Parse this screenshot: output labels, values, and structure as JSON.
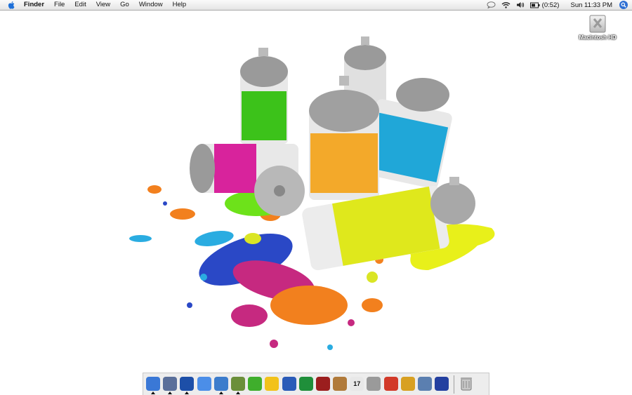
{
  "menubar": {
    "apple_icon": "apple-icon",
    "app_name": "Finder",
    "menus": [
      "File",
      "Edit",
      "View",
      "Go",
      "Window",
      "Help"
    ],
    "status": {
      "icons": [
        "speech-bubble-icon",
        "wifi-icon",
        "volume-icon",
        "battery-icon"
      ],
      "battery_time": "(0:52)",
      "clock": "Sun 11:33 PM",
      "search_icon": "spotlight-icon"
    }
  },
  "desktop": {
    "drive_label": "Macintosh HD",
    "wallpaper": "spray paint cans with colorful paint splatter"
  },
  "dock": {
    "apps": [
      {
        "name": "finder-icon",
        "color": "#3a78d6",
        "running": true
      },
      {
        "name": "mail-stamp-icon",
        "color": "#5a6f9a",
        "running": true
      },
      {
        "name": "globe-network-icon",
        "color": "#1d4fa8",
        "running": true
      },
      {
        "name": "ichat-icon",
        "color": "#4b8ee8",
        "running": false
      },
      {
        "name": "itunes-icon",
        "color": "#3c7ccc",
        "running": true
      },
      {
        "name": "pen-icon",
        "color": "#6b8f3a",
        "running": true
      },
      {
        "name": "green-swirl-icon",
        "color": "#3fae2c",
        "running": false
      },
      {
        "name": "duck-icon",
        "color": "#f2c21a",
        "running": false
      },
      {
        "name": "word-icon",
        "color": "#2a5bb8",
        "running": false
      },
      {
        "name": "green-star-icon",
        "color": "#1f8f3a",
        "running": false
      },
      {
        "name": "photo-booth-icon",
        "color": "#9b1e1e",
        "running": false
      },
      {
        "name": "iphoto-icon",
        "color": "#b07a3a",
        "running": false
      },
      {
        "name": "ical-icon",
        "color": "#e8e8e8",
        "running": false
      },
      {
        "name": "system-prefs-icon",
        "color": "#9a9a9a",
        "running": false
      },
      {
        "name": "red-app-icon",
        "color": "#d23a2a",
        "running": false
      },
      {
        "name": "warcraft-icon",
        "color": "#d8a022",
        "running": false
      },
      {
        "name": "headset-icon",
        "color": "#5b7fb0",
        "running": false
      },
      {
        "name": "wizard-icon",
        "color": "#2440a0",
        "running": false
      }
    ],
    "ical_date": "17",
    "trash": "trash-icon"
  }
}
